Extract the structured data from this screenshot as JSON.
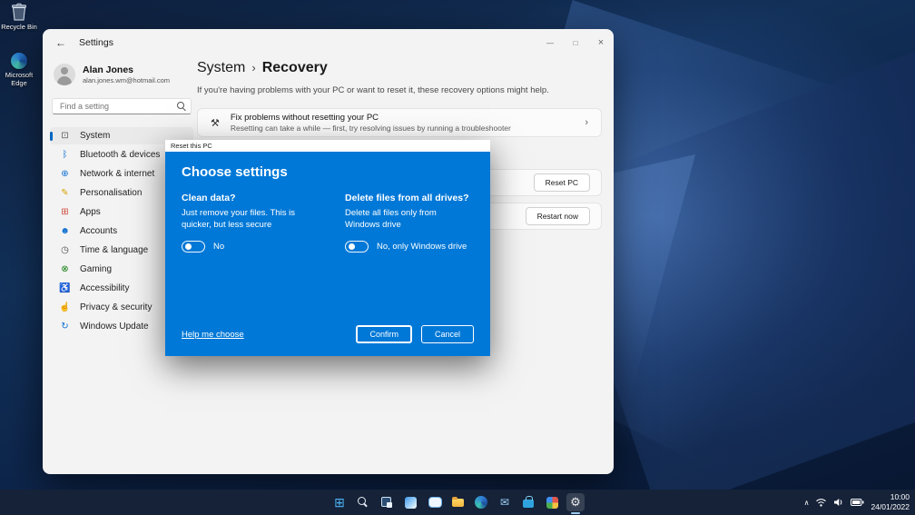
{
  "desktop": {
    "icons": [
      {
        "label": "Recycle Bin"
      },
      {
        "label": "Microsoft Edge"
      }
    ]
  },
  "window": {
    "title": "Settings",
    "back_glyph": "←",
    "controls": {
      "minimize": "—",
      "maximize": "□",
      "close": "×"
    },
    "profile": {
      "name": "Alan Jones",
      "email": "alan.jones.wm@hotmail.com"
    },
    "search": {
      "placeholder": "Find a setting"
    },
    "nav": [
      {
        "label": "System",
        "glyph": "⊡",
        "selected": true
      },
      {
        "label": "Bluetooth & devices",
        "glyph": "ᛒ"
      },
      {
        "label": "Network & internet",
        "glyph": "⊕"
      },
      {
        "label": "Personalisation",
        "glyph": "✎"
      },
      {
        "label": "Apps",
        "glyph": "⊞"
      },
      {
        "label": "Accounts",
        "glyph": "☻"
      },
      {
        "label": "Time & language",
        "glyph": "◷"
      },
      {
        "label": "Gaming",
        "glyph": "⊗"
      },
      {
        "label": "Accessibility",
        "glyph": "♿"
      },
      {
        "label": "Privacy & security",
        "glyph": "☝"
      },
      {
        "label": "Windows Update",
        "glyph": "↻"
      }
    ],
    "main": {
      "breadcrumb": {
        "root": "System",
        "separator": "›",
        "current": "Recovery"
      },
      "intro": "If you're having problems with your PC or want to reset it, these recovery options might help.",
      "troubleshoot_card": {
        "icon_glyph": "⚒",
        "title": "Fix problems without resetting your PC",
        "subtitle": "Resetting can take a while — first, try resolving issues by running a troubleshooter",
        "chevron": "›"
      },
      "reset_button": "Reset PC",
      "restart_button": "Restart now"
    }
  },
  "dialog": {
    "title": "Reset this PC",
    "heading": "Choose settings",
    "clean_data": {
      "title": "Clean data?",
      "description": "Just remove your files. This is quicker, but less secure",
      "toggle_label": "No",
      "toggle_state": "off"
    },
    "all_drives": {
      "title": "Delete files from all drives?",
      "description": "Delete all files only from Windows drive",
      "toggle_label": "No, only Windows drive",
      "toggle_state": "off"
    },
    "help_link": "Help me choose",
    "confirm_label": "Confirm",
    "cancel_label": "Cancel"
  },
  "taskbar": {
    "icons": [
      {
        "name": "start",
        "glyph": "⊞"
      },
      {
        "name": "search",
        "glyph": ""
      },
      {
        "name": "task-view",
        "glyph": ""
      },
      {
        "name": "widgets",
        "glyph": ""
      },
      {
        "name": "chat",
        "glyph": ""
      },
      {
        "name": "file-explorer",
        "glyph": ""
      },
      {
        "name": "edge",
        "glyph": ""
      },
      {
        "name": "mail",
        "glyph": "✉"
      },
      {
        "name": "store",
        "glyph": ""
      },
      {
        "name": "photos",
        "glyph": ""
      },
      {
        "name": "settings",
        "glyph": "⚙",
        "active": true
      }
    ],
    "tray": {
      "chevron": "∧",
      "time": "10:00",
      "date": "24/01/2022"
    }
  },
  "colors": {
    "accent": "#0067c0",
    "dialog_blue": "#0078d7",
    "taskbar_bg": "#152238"
  }
}
